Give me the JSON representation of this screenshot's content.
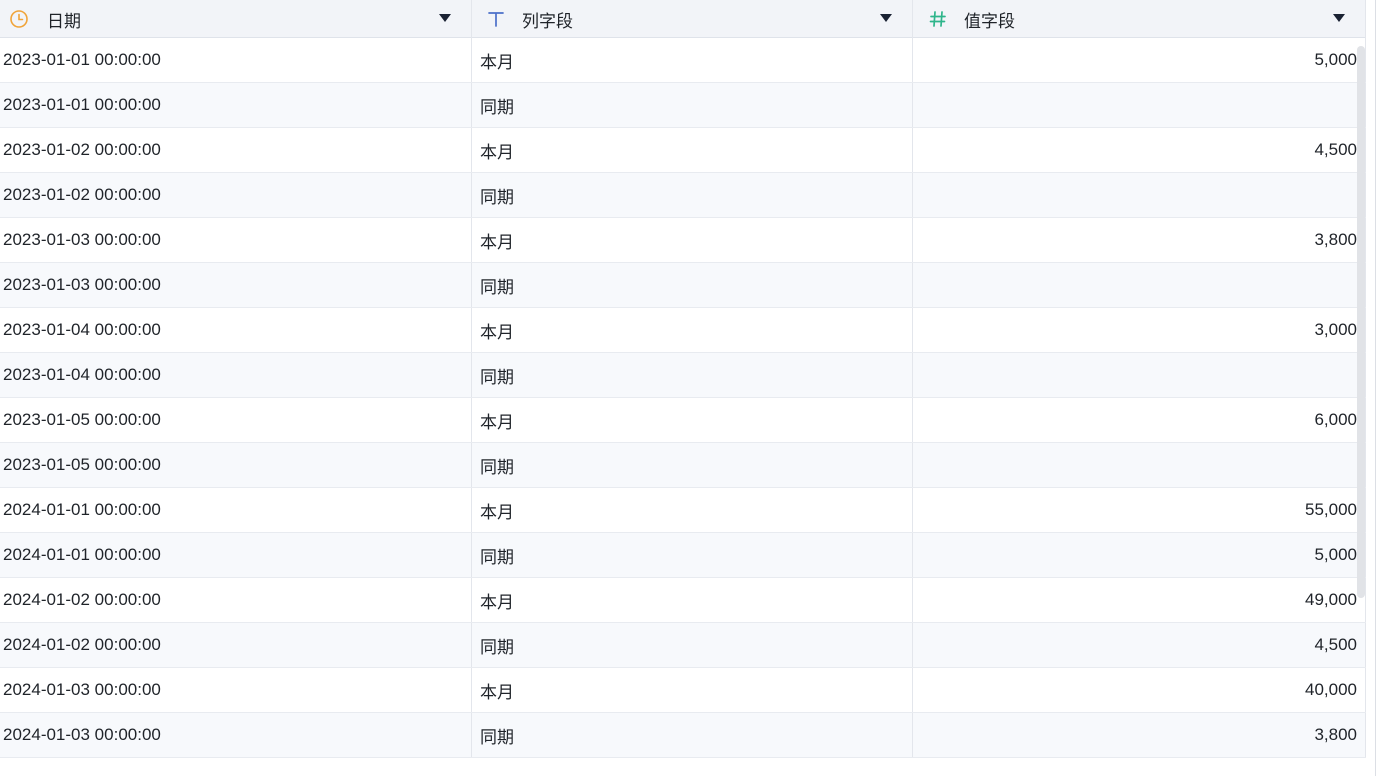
{
  "columns": [
    {
      "label": "日期",
      "type_icon": "clock-icon",
      "icon_color": "#f0a43a"
    },
    {
      "label": "列字段",
      "type_icon": "text-type-icon",
      "icon_color": "#4c6fc9"
    },
    {
      "label": "值字段",
      "type_icon": "hash-icon",
      "icon_color": "#2eb58b"
    }
  ],
  "rows": [
    {
      "date": "2023-01-01 00:00:00",
      "field": "本月",
      "value": "5,000"
    },
    {
      "date": "2023-01-01 00:00:00",
      "field": "同期",
      "value": ""
    },
    {
      "date": "2023-01-02 00:00:00",
      "field": "本月",
      "value": "4,500"
    },
    {
      "date": "2023-01-02 00:00:00",
      "field": "同期",
      "value": ""
    },
    {
      "date": "2023-01-03 00:00:00",
      "field": "本月",
      "value": "3,800"
    },
    {
      "date": "2023-01-03 00:00:00",
      "field": "同期",
      "value": ""
    },
    {
      "date": "2023-01-04 00:00:00",
      "field": "本月",
      "value": "3,000"
    },
    {
      "date": "2023-01-04 00:00:00",
      "field": "同期",
      "value": ""
    },
    {
      "date": "2023-01-05 00:00:00",
      "field": "本月",
      "value": "6,000"
    },
    {
      "date": "2023-01-05 00:00:00",
      "field": "同期",
      "value": ""
    },
    {
      "date": "2024-01-01 00:00:00",
      "field": "本月",
      "value": "55,000"
    },
    {
      "date": "2024-01-01 00:00:00",
      "field": "同期",
      "value": "5,000"
    },
    {
      "date": "2024-01-02 00:00:00",
      "field": "本月",
      "value": "49,000"
    },
    {
      "date": "2024-01-02 00:00:00",
      "field": "同期",
      "value": "4,500"
    },
    {
      "date": "2024-01-03 00:00:00",
      "field": "本月",
      "value": "40,000"
    },
    {
      "date": "2024-01-03 00:00:00",
      "field": "同期",
      "value": "3,800"
    }
  ]
}
